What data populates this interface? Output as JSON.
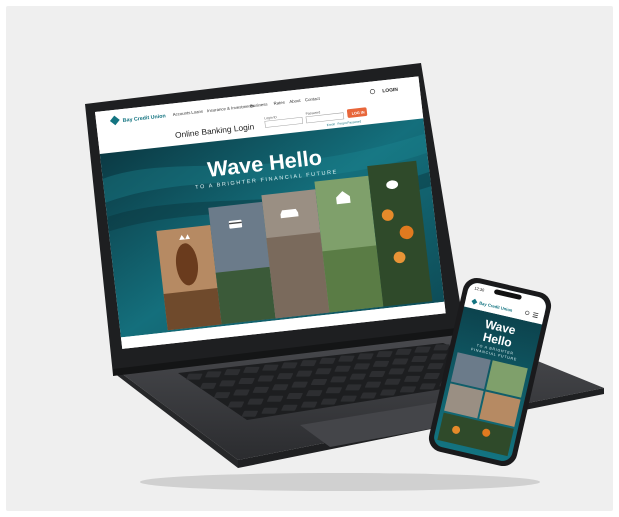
{
  "site": {
    "brand": "Bay Credit Union",
    "nav": [
      "Accounts",
      "Loans",
      "Insurance & Investments",
      "Business",
      "Rates",
      "About",
      "Contact"
    ],
    "login_link": "LOGIN",
    "login_title": "Online Banking Login",
    "login_id_label": "Login ID",
    "password_label": "Password",
    "login_button": "LOG IN",
    "enroll_link": "Enroll",
    "forgot_link": "Forgot Password",
    "hero_title": "Wave Hello",
    "hero_subtitle": "TO A BRIGHTER FINANCIAL FUTURE"
  },
  "phone": {
    "time": "12:30",
    "brand": "Bay Credit Union",
    "hero_title_line1": "Wave",
    "hero_title_line2": "Hello",
    "hero_subtitle_line1": "TO A BRIGHTER",
    "hero_subtitle_line2": "FINANCIAL FUTURE"
  },
  "colors": {
    "teal_dark": "#0c4650",
    "teal": "#137481",
    "accent_orange": "#e8663a",
    "laptop_body": "#3a3b3e"
  },
  "icons": [
    "hand-icon",
    "card-icon",
    "car-icon",
    "house-icon",
    "piggy-bank-icon",
    "search-icon",
    "menu-icon"
  ]
}
